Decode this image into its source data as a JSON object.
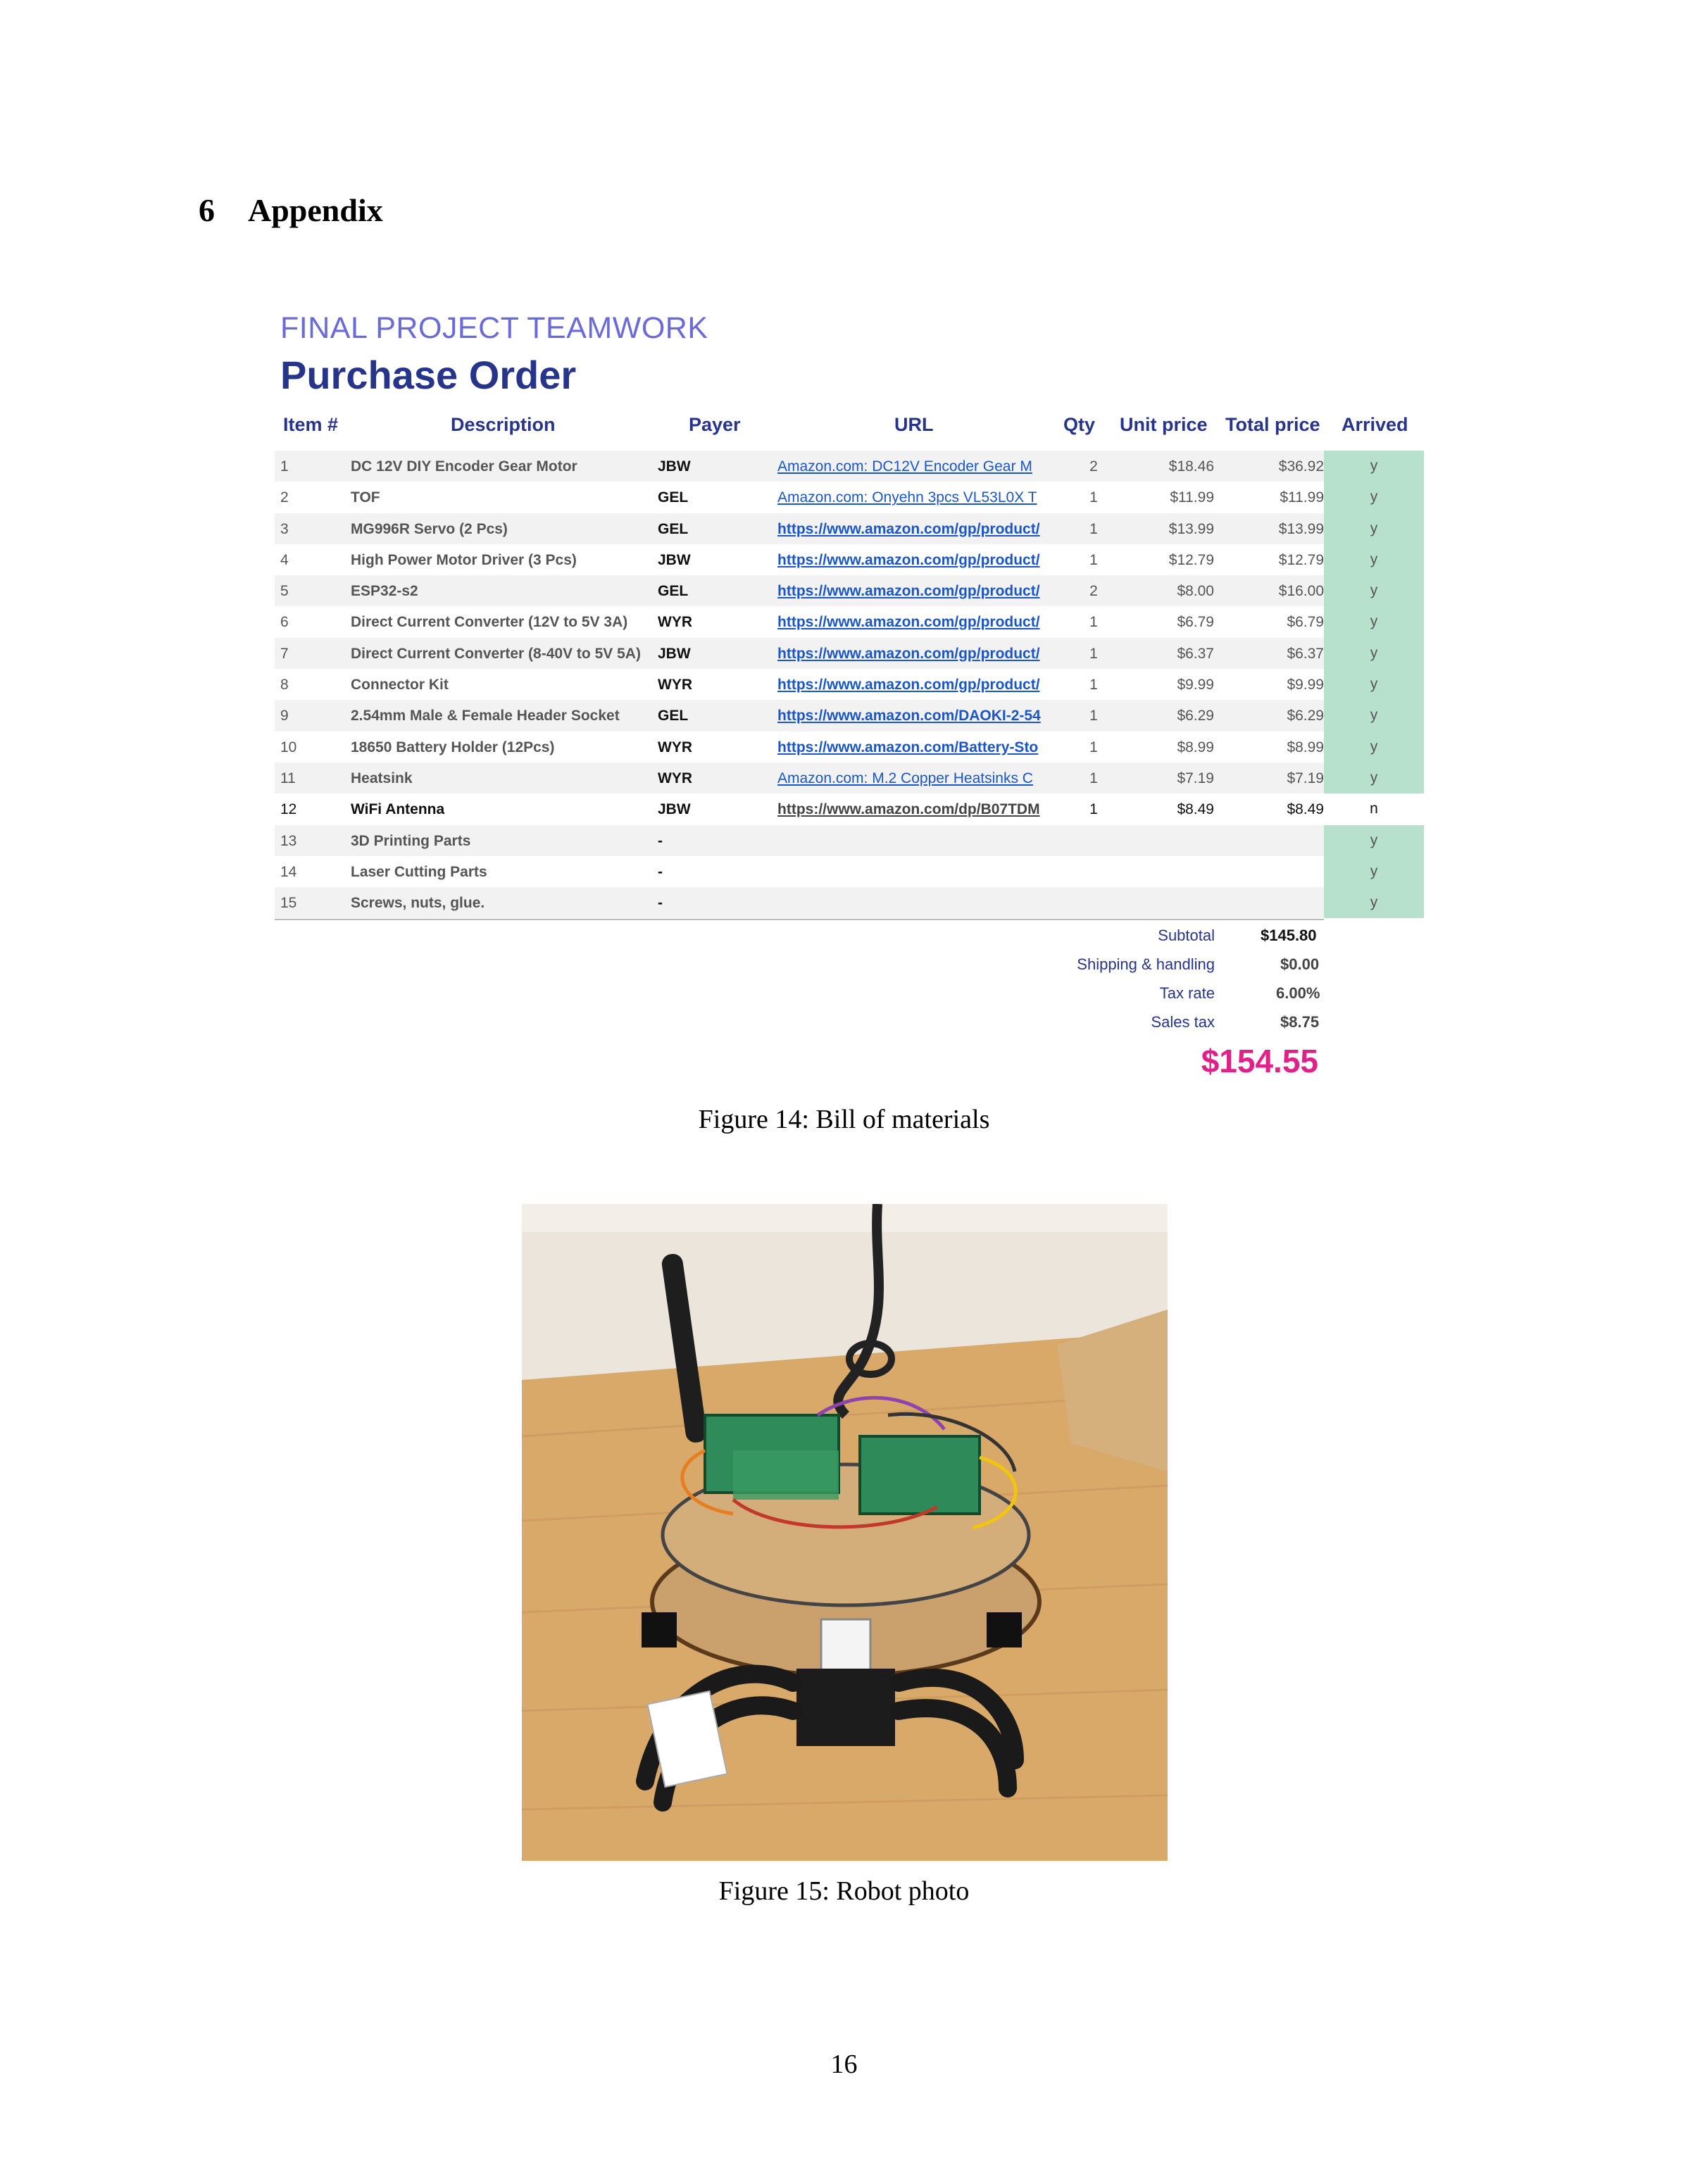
{
  "section": {
    "number": "6",
    "title": "Appendix"
  },
  "purchase_order": {
    "kicker": "FINAL PROJECT TEAMWORK",
    "title": "Purchase Order",
    "headers": {
      "item": "Item #",
      "description": "Description",
      "payer": "Payer",
      "url": "URL",
      "qty": "Qty",
      "unit_price": "Unit price",
      "total_price": "Total price",
      "arrived": "Arrived"
    },
    "rows": [
      {
        "item": "1",
        "description": "DC 12V DIY Encoder Gear Motor",
        "payer": "JBW",
        "url": "Amazon.com: DC12V Encoder Gear M",
        "qty": "2",
        "unit": "$18.46",
        "total": "$36.92",
        "arrived": "y"
      },
      {
        "item": "2",
        "description": "TOF",
        "payer": "GEL",
        "url": "Amazon.com: Onyehn 3pcs VL53L0X T",
        "qty": "1",
        "unit": "$11.99",
        "total": "$11.99",
        "arrived": "y"
      },
      {
        "item": "3",
        "description": "MG996R Servo (2 Pcs)",
        "payer": "GEL",
        "url": "https://www.amazon.com/gp/product/",
        "qty": "1",
        "unit": "$13.99",
        "total": "$13.99",
        "arrived": "y"
      },
      {
        "item": "4",
        "description": "High Power Motor Driver (3 Pcs)",
        "payer": "JBW",
        "url": "https://www.amazon.com/gp/product/",
        "qty": "1",
        "unit": "$12.79",
        "total": "$12.79",
        "arrived": "y"
      },
      {
        "item": "5",
        "description": "ESP32-s2",
        "payer": "GEL",
        "url": "https://www.amazon.com/gp/product/",
        "qty": "2",
        "unit": "$8.00",
        "total": "$16.00",
        "arrived": "y"
      },
      {
        "item": "6",
        "description": "Direct Current Converter (12V to 5V 3A)",
        "payer": "WYR",
        "url": "https://www.amazon.com/gp/product/",
        "qty": "1",
        "unit": "$6.79",
        "total": "$6.79",
        "arrived": "y"
      },
      {
        "item": "7",
        "description": "Direct Current Converter (8-40V to 5V 5A)",
        "payer": "JBW",
        "url": "https://www.amazon.com/gp/product/",
        "qty": "1",
        "unit": "$6.37",
        "total": "$6.37",
        "arrived": "y"
      },
      {
        "item": "8",
        "description": "Connector Kit",
        "payer": "WYR",
        "url": "https://www.amazon.com/gp/product/",
        "qty": "1",
        "unit": "$9.99",
        "total": "$9.99",
        "arrived": "y"
      },
      {
        "item": "9",
        "description": "2.54mm Male & Female Header Socket",
        "payer": "GEL",
        "url": "https://www.amazon.com/DAOKI-2-54",
        "qty": "1",
        "unit": "$6.29",
        "total": "$6.29",
        "arrived": "y"
      },
      {
        "item": "10",
        "description": "18650 Battery Holder (12Pcs)",
        "payer": "WYR",
        "url": "https://www.amazon.com/Battery-Sto",
        "qty": "1",
        "unit": "$8.99",
        "total": "$8.99",
        "arrived": "y"
      },
      {
        "item": "11",
        "description": "Heatsink",
        "payer": "WYR",
        "url": "Amazon.com: M.2 Copper Heatsinks C",
        "qty": "1",
        "unit": "$7.19",
        "total": "$7.19",
        "arrived": "y"
      },
      {
        "item": "12",
        "description": "WiFi Antenna",
        "payer": "JBW",
        "url": "https://www.amazon.com/dp/B07TDM",
        "qty": "1",
        "unit": "$8.49",
        "total": "$8.49",
        "arrived": "n"
      },
      {
        "item": "13",
        "description": "3D Printing Parts",
        "payer": "-",
        "url": "",
        "qty": "",
        "unit": "",
        "total": "",
        "arrived": "y"
      },
      {
        "item": "14",
        "description": "Laser Cutting Parts",
        "payer": "-",
        "url": "",
        "qty": "",
        "unit": "",
        "total": "",
        "arrived": "y"
      },
      {
        "item": "15",
        "description": "Screws, nuts,  glue.",
        "payer": "-",
        "url": "",
        "qty": "",
        "unit": "",
        "total": "",
        "arrived": "y"
      }
    ],
    "summary": {
      "subtotal_label": "Subtotal",
      "subtotal": "$145.80",
      "shipping_label": "Shipping & handling",
      "shipping": "$0.00",
      "tax_rate_label": "Tax rate",
      "tax_rate": "6.00%",
      "sales_tax_label": "Sales tax",
      "sales_tax": "$8.75",
      "grand_total": "$154.55"
    },
    "colors": {
      "heading": "#27348b",
      "kicker": "#6a6ad8",
      "arrived_fill": "#b7e1cd",
      "grand_total": "#e0218a",
      "link": "#1a56c9"
    }
  },
  "figure14_caption": "Figure 14: Bill of materials",
  "figure15_caption": "Figure 15: Robot photo",
  "page_number": "16"
}
